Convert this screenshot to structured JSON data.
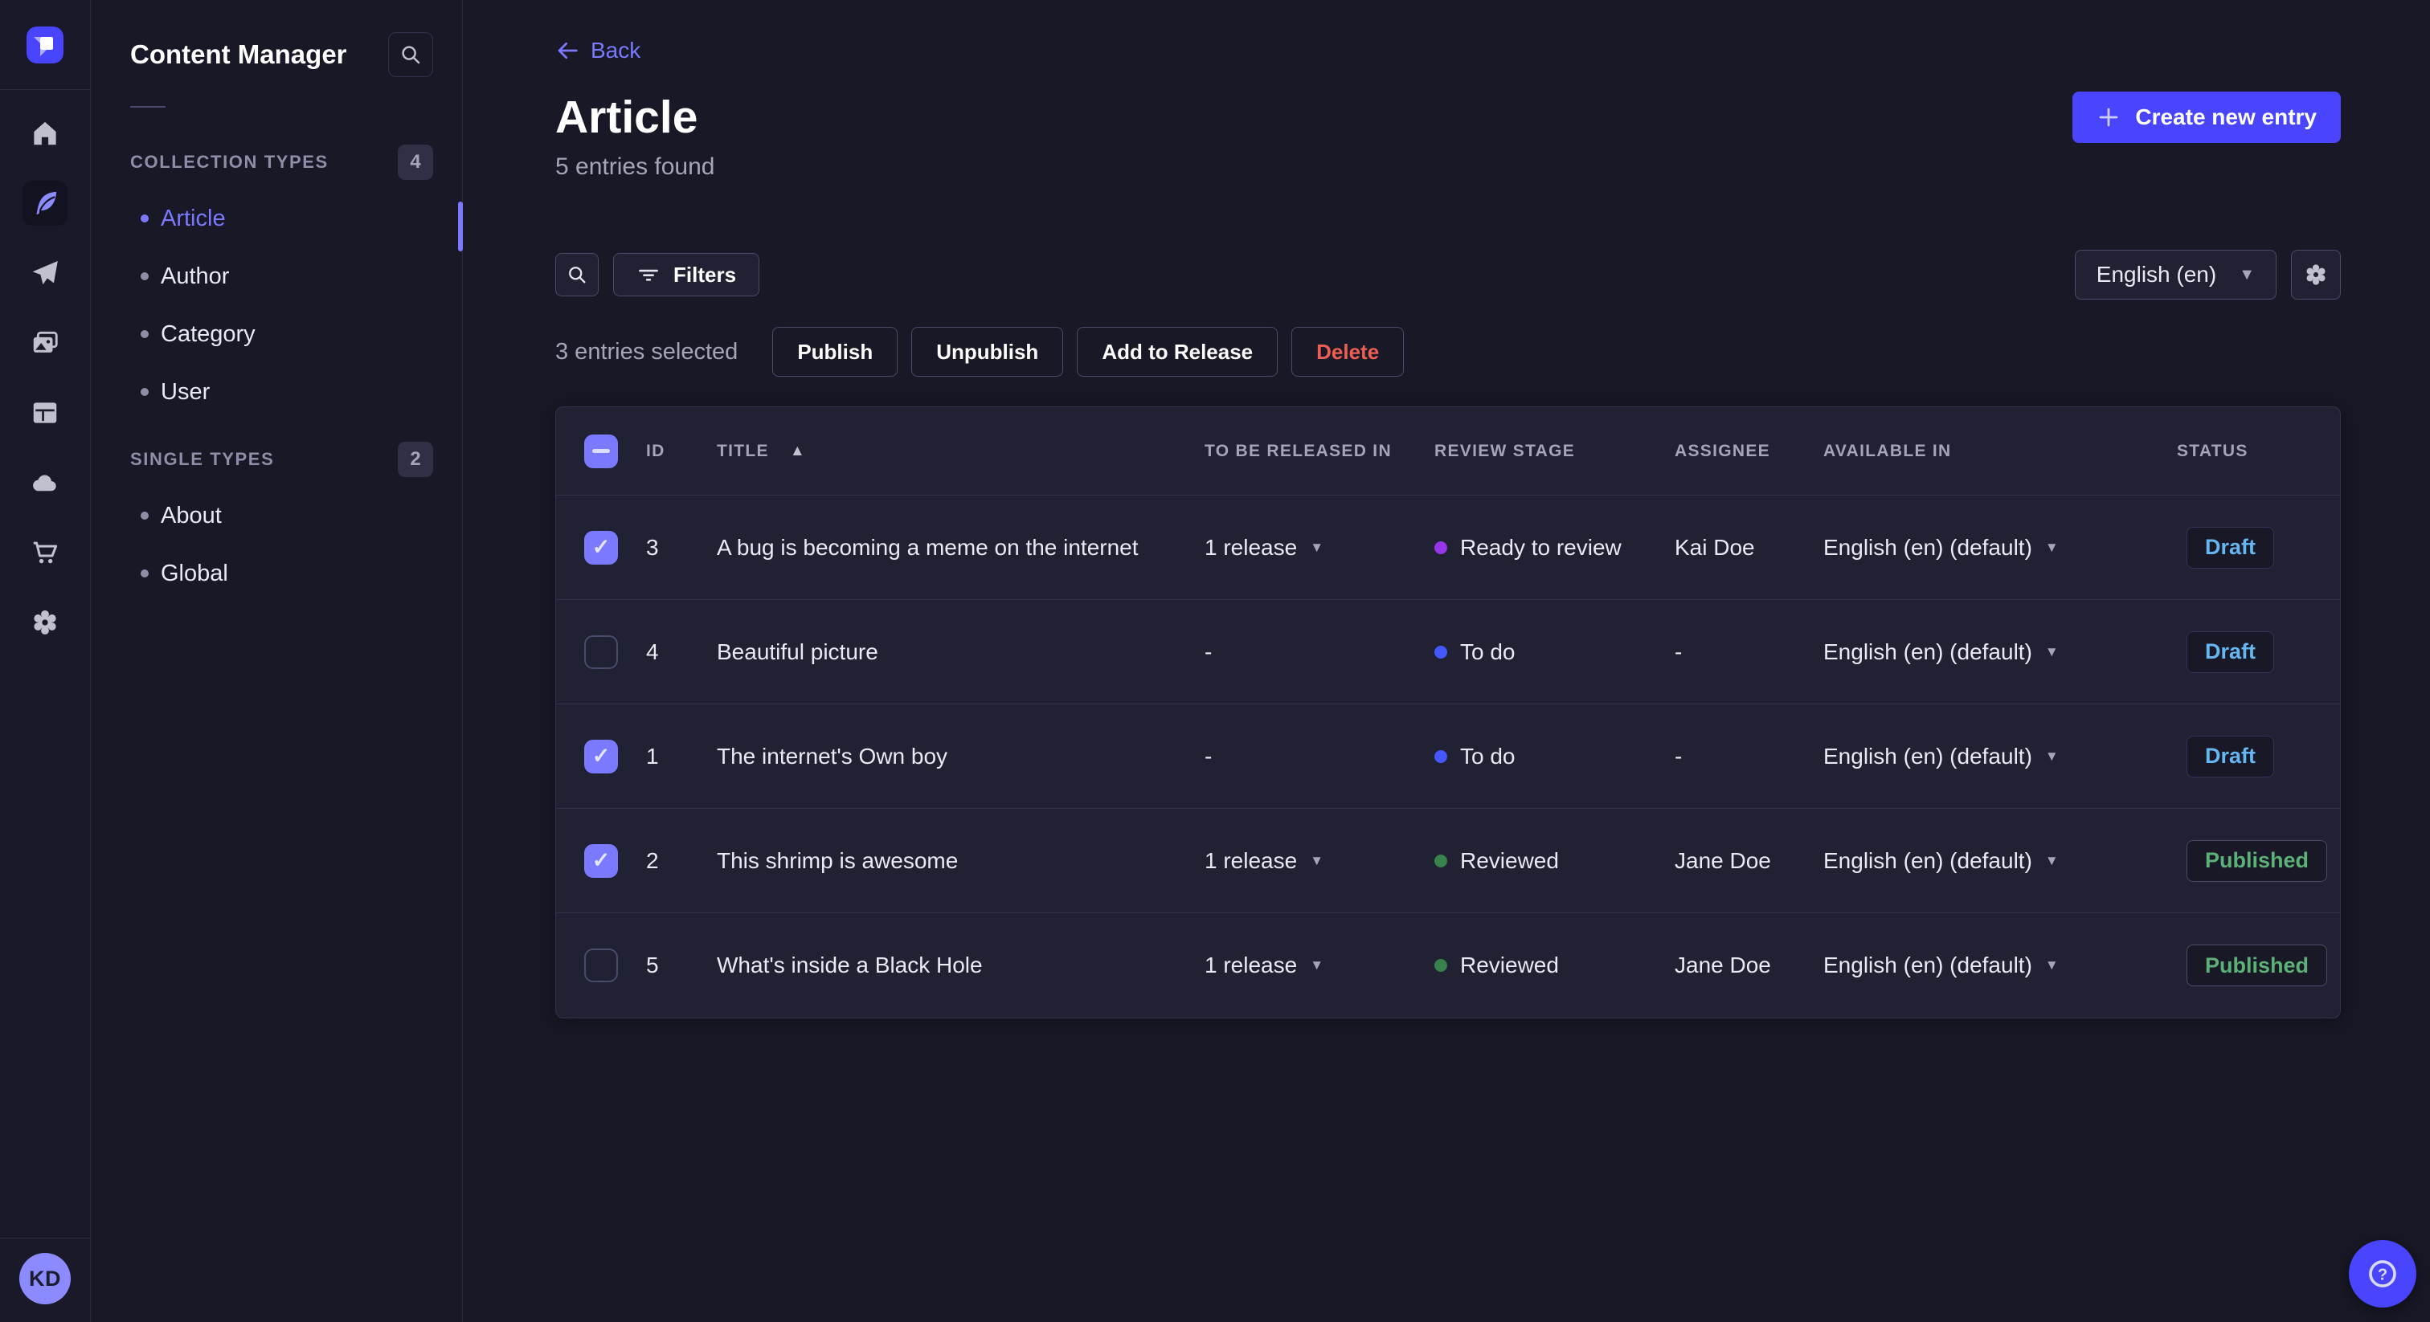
{
  "colors": {
    "brand": "#4945ff",
    "accent": "#7b79ff",
    "draft_text": "#66b7f1",
    "published_text": "#5cb176",
    "danger_text": "#ee5e52"
  },
  "icons": {
    "sort_asc": "▲",
    "caret_down": "▼"
  },
  "rail": {
    "avatar_initials": "KD"
  },
  "sidebar": {
    "title": "Content Manager",
    "sections": [
      {
        "label": "COLLECTION TYPES",
        "count": "4",
        "items": [
          {
            "label": "Article",
            "active": "true"
          },
          {
            "label": "Author",
            "active": "false"
          },
          {
            "label": "Category",
            "active": "false"
          },
          {
            "label": "User",
            "active": "false"
          }
        ]
      },
      {
        "label": "SINGLE TYPES",
        "count": "2",
        "items": [
          {
            "label": "About",
            "active": "false"
          },
          {
            "label": "Global",
            "active": "false"
          }
        ]
      }
    ]
  },
  "header": {
    "back": "Back",
    "title": "Article",
    "subtitle": "5 entries found",
    "create_button": "Create new entry"
  },
  "toolbar": {
    "filters": "Filters",
    "locale": "English (en)"
  },
  "selection": {
    "summary": "3 entries selected",
    "publish": "Publish",
    "unpublish": "Unpublish",
    "add_to_release": "Add to Release",
    "delete": "Delete"
  },
  "table": {
    "header_checkbox": "indeterminate",
    "columns": {
      "id": "ID",
      "title": "TITLE",
      "released": "TO BE RELEASED IN",
      "stage": "REVIEW STAGE",
      "assignee": "ASSIGNEE",
      "available": "AVAILABLE IN",
      "status": "STATUS"
    },
    "rows": [
      {
        "checkbox": "checked",
        "id": "3",
        "title": "A bug is becoming a meme on the internet",
        "release": "1 release",
        "release_caret": "true",
        "stage_label": "Ready to review",
        "stage_color": "#9736e8",
        "assignee": "Kai Doe",
        "locale": "English (en) (default)",
        "status_label": "Draft",
        "status_variant": "draft"
      },
      {
        "checkbox": "unchecked",
        "id": "4",
        "title": "Beautiful picture",
        "release": "-",
        "release_caret": "false",
        "stage_label": "To do",
        "stage_color": "#4558ff",
        "assignee": "-",
        "locale": "English (en) (default)",
        "status_label": "Draft",
        "status_variant": "draft"
      },
      {
        "checkbox": "checked",
        "id": "1",
        "title": "The internet's Own boy",
        "release": "-",
        "release_caret": "false",
        "stage_label": "To do",
        "stage_color": "#4558ff",
        "assignee": "-",
        "locale": "English (en) (default)",
        "status_label": "Draft",
        "status_variant": "draft"
      },
      {
        "checkbox": "checked",
        "id": "2",
        "title": "This shrimp is awesome",
        "release": "1 release",
        "release_caret": "true",
        "stage_label": "Reviewed",
        "stage_color": "#38824d",
        "assignee": "Jane Doe",
        "locale": "English (en) (default)",
        "status_label": "Published",
        "status_variant": "published"
      },
      {
        "checkbox": "unchecked",
        "id": "5",
        "title": "What's inside a Black Hole",
        "release": "1 release",
        "release_caret": "true",
        "stage_label": "Reviewed",
        "stage_color": "#38824d",
        "assignee": "Jane Doe",
        "locale": "English (en) (default)",
        "status_label": "Published",
        "status_variant": "published"
      }
    ]
  }
}
